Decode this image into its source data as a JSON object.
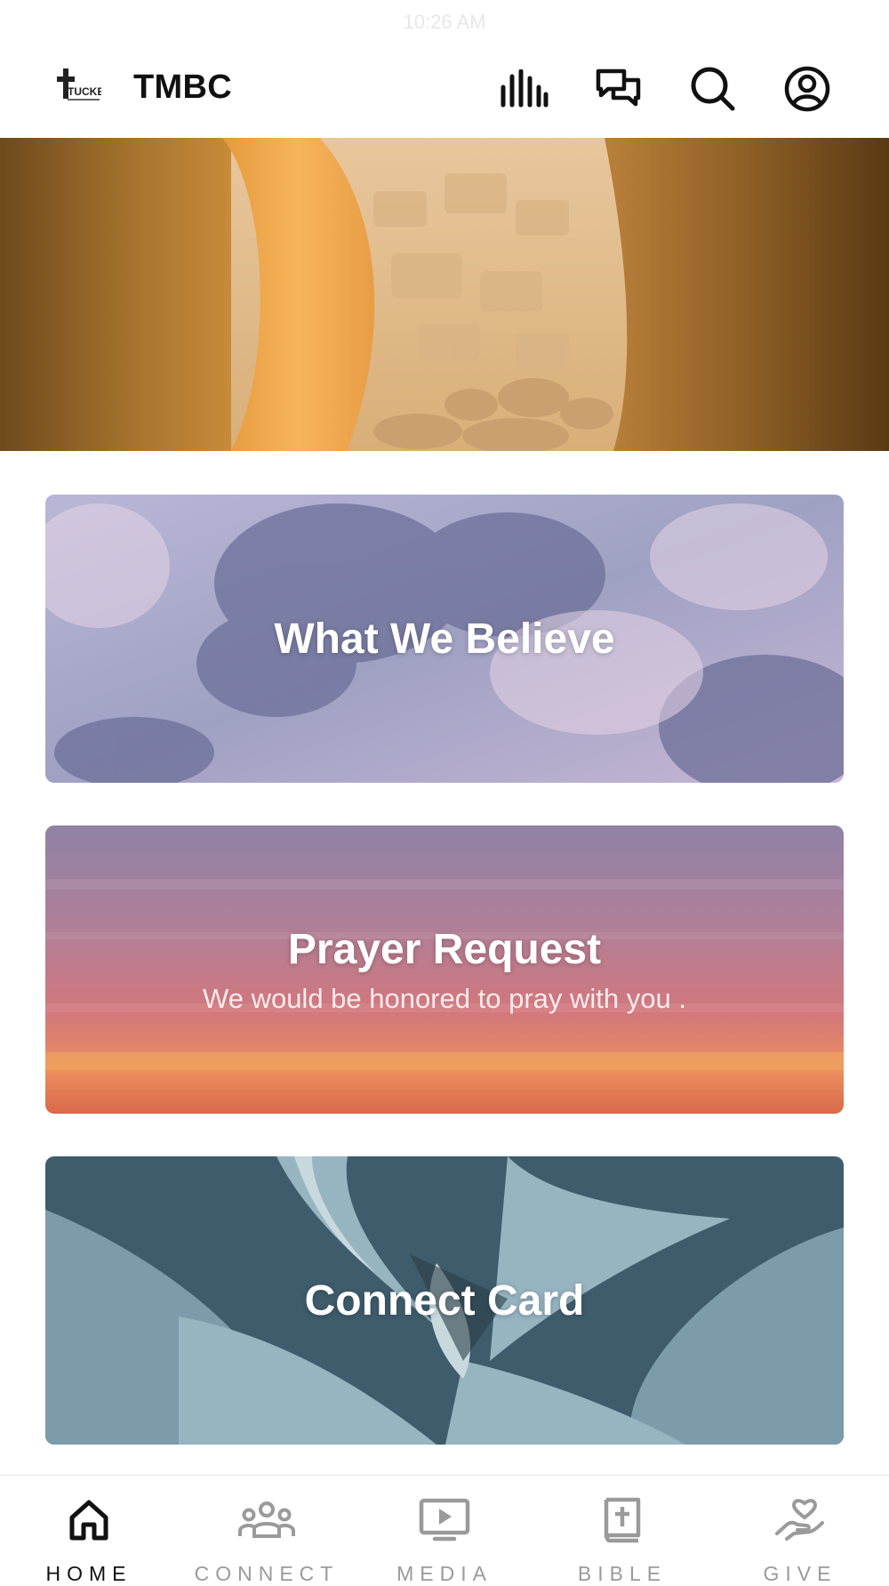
{
  "status_bar": {
    "time": "10:26 AM"
  },
  "header": {
    "logo_text": "TUCKER",
    "title": "TMBC",
    "icons": [
      "audio-bars-icon",
      "chat-bubbles-icon",
      "search-icon",
      "account-icon"
    ]
  },
  "hero": {
    "image": "open-tomb-photo"
  },
  "cards": [
    {
      "title": "What We Believe",
      "subtitle": "",
      "image": "clouds-photo"
    },
    {
      "title": "Prayer Request",
      "subtitle": "We would be honored to pray with you .",
      "image": "sunset-photo"
    },
    {
      "title": "Connect Card",
      "subtitle": "",
      "image": "succulent-photo"
    }
  ],
  "tabs": [
    {
      "label": "HOME",
      "icon": "home-icon",
      "active": true
    },
    {
      "label": "CONNECT",
      "icon": "people-icon",
      "active": false
    },
    {
      "label": "MEDIA",
      "icon": "play-screen-icon",
      "active": false
    },
    {
      "label": "BIBLE",
      "icon": "bible-icon",
      "active": false
    },
    {
      "label": "GIVE",
      "icon": "heart-hand-icon",
      "active": false
    }
  ],
  "colors": {
    "active_tab": "#111111",
    "inactive_tab": "#9a9a9a",
    "card_text": "#ffffff"
  }
}
